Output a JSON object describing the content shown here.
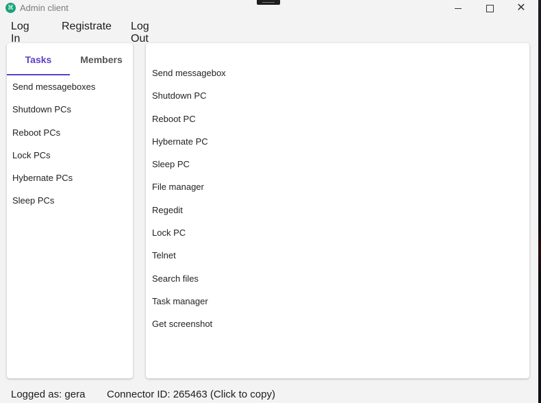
{
  "window": {
    "title": "Admin client",
    "icon": "app-logo-icon",
    "controls": {
      "minimize_icon": "minimize-icon",
      "maximize_icon": "maximize-icon",
      "close_glyph": "✕"
    }
  },
  "menu": {
    "login": "Log In",
    "registrate": "Registrate",
    "logout": "Log Out"
  },
  "left_panel": {
    "tabs": [
      {
        "label": "Tasks",
        "active": true
      },
      {
        "label": "Members",
        "active": false
      }
    ],
    "tasks": [
      "Send messageboxes",
      "Shutdown PCs",
      "Reboot PCs",
      "Lock PCs",
      "Hybernate PCs",
      "Sleep PCs"
    ]
  },
  "right_panel": {
    "actions": [
      "Send messagebox",
      "Shutdown PC",
      "Reboot PC",
      "Hybernate PC",
      "Sleep PC",
      "File manager",
      "Regedit",
      "Lock PC",
      "Telnet",
      "Search files",
      "Task manager",
      "Get screenshot"
    ]
  },
  "status": {
    "logged_as": "Logged as: gera",
    "connector": "Connector ID: 265463 (Click to copy)"
  },
  "colors": {
    "accent": "#5b3fc9",
    "app_icon": "#1aa37a"
  }
}
